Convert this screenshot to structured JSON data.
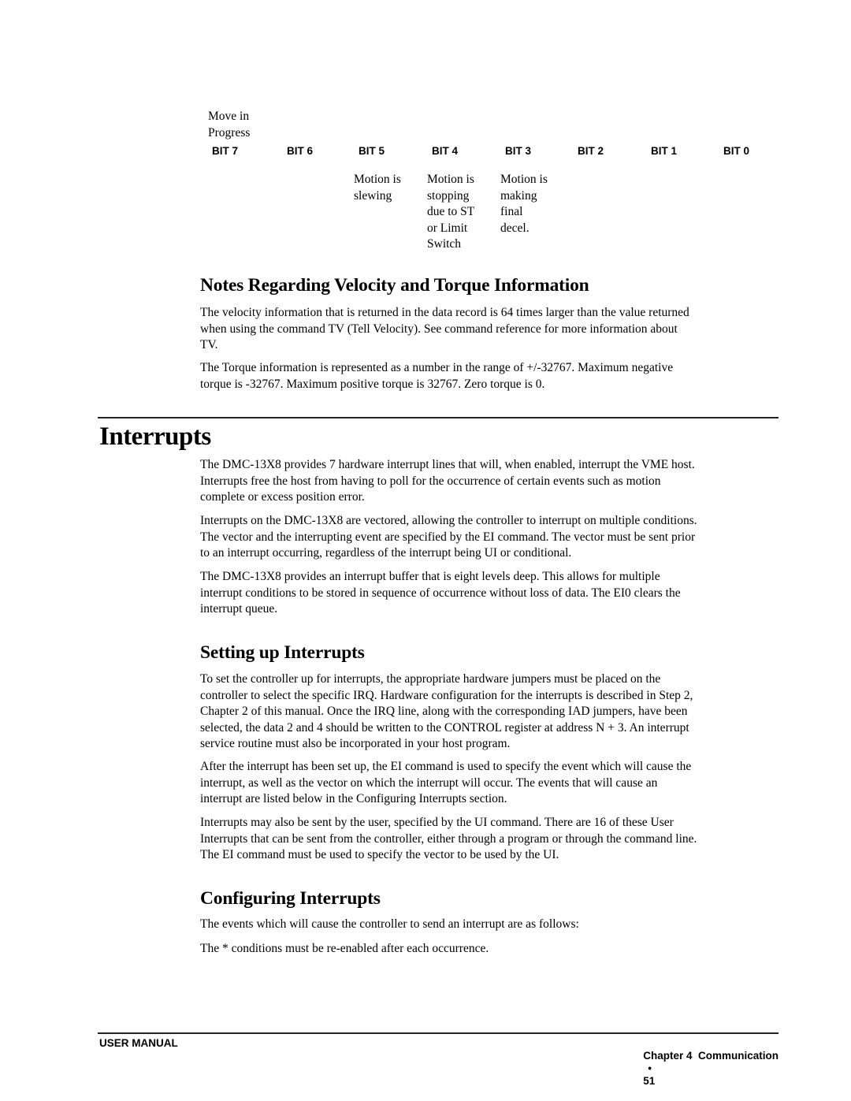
{
  "bit_table": {
    "top_label": [
      "Move in",
      "Progress"
    ],
    "headers": [
      "BIT 7",
      "BIT 6",
      "BIT 5",
      "BIT 4",
      "BIT 3",
      "BIT 2",
      "BIT 1",
      "BIT 0"
    ],
    "descriptions": {
      "bit5": [
        "Motion is",
        "slewing"
      ],
      "bit4": [
        "Motion is",
        "stopping",
        "due to ST",
        "or Limit",
        "Switch"
      ],
      "bit3": [
        "Motion is",
        "making",
        "final",
        "decel."
      ]
    }
  },
  "notes_section": {
    "heading": "Notes Regarding Velocity and Torque Information",
    "paragraphs": [
      [
        "The velocity information that is returned in the data record is 64 times larger than the value returned",
        "when using the command TV (Tell Velocity).  See command reference for more information about",
        "TV."
      ],
      [
        "The Torque information is represented as a number in the range of +/-32767.  Maximum negative",
        "torque is -32767.  Maximum positive torque is 32767.  Zero torque is 0."
      ]
    ]
  },
  "interrupts_section": {
    "heading": "Interrupts",
    "paragraphs": [
      [
        "The DMC-13X8 provides 7 hardware interrupt lines that will, when enabled, interrupt the VME host.",
        "Interrupts free the host from having to poll for the occurrence of certain events such as motion",
        "complete or excess position error."
      ],
      [
        "Interrupts on the DMC-13X8 are vectored, allowing the controller to interrupt on multiple conditions.",
        "The vector and the interrupting event are specified by the EI command.  The vector must be sent prior",
        "to an interrupt occurring, regardless of the interrupt being UI or conditional."
      ],
      [
        "The DMC-13X8 provides an interrupt buffer that is eight levels deep.  This allows for multiple",
        "interrupt conditions to be stored in sequence of occurrence without loss of data.  The EI0 clears the",
        "interrupt queue."
      ]
    ]
  },
  "setting_up_section": {
    "heading": "Setting up Interrupts",
    "paragraphs": [
      [
        "To set the controller up for interrupts, the appropriate hardware jumpers must be placed on the",
        "controller to select the specific IRQ. Hardware configuration for the interrupts is described in Step 2,",
        "Chapter 2 of this manual.  Once the IRQ line, along with the corresponding IAD jumpers, have been",
        "selected, the data 2 and 4 should be written to the CONTROL register at address N + 3.  An interrupt",
        "service routine must also be incorporated in your host program."
      ],
      [
        "After the interrupt has been set up, the EI command is used to specify the event which will cause the",
        "interrupt, as well as the vector on which the interrupt will occur.  The events that will cause an",
        "interrupt are listed below in the Configuring Interrupts section."
      ],
      [
        "Interrupts may also be sent by the user, specified by the UI command.  There are 16 of these User",
        "Interrupts that can be sent from the controller, either through a program or through the command line.",
        "The EI command must be used to specify the vector to be used by the UI."
      ]
    ]
  },
  "configuring_section": {
    "heading": "Configuring Interrupts",
    "paragraphs": [
      [
        "The events which will cause the controller to send an interrupt are as follows:"
      ],
      [
        "The * conditions must be re-enabled after each occurrence."
      ]
    ]
  },
  "footer": {
    "left": "USER MANUAL",
    "chapter": "Chapter 4  Communication",
    "bullet": "•",
    "page_number": "51"
  }
}
